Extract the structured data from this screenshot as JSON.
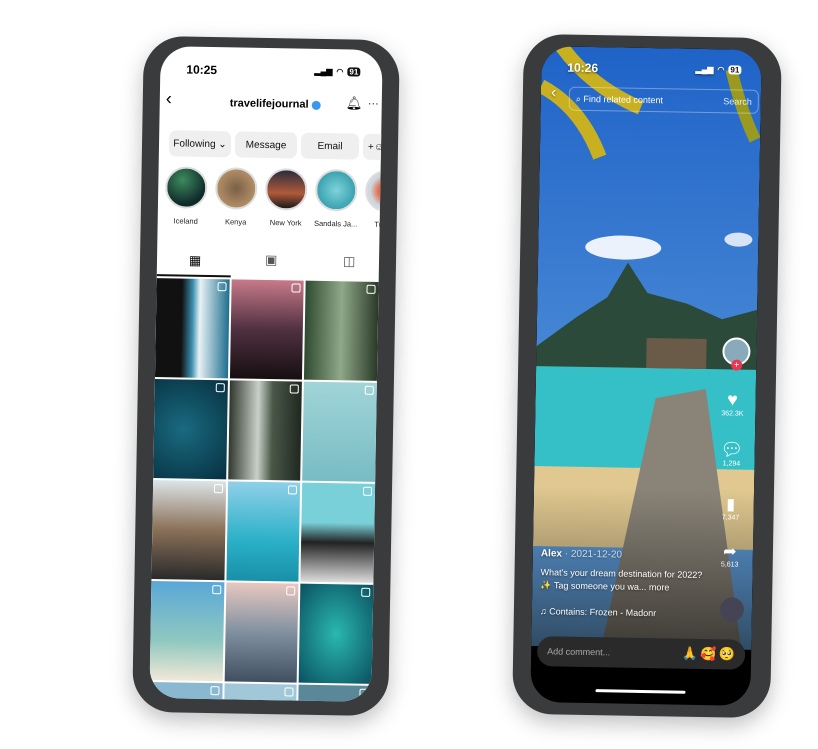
{
  "left_phone": {
    "status": {
      "time": "10:25",
      "battery": "91"
    },
    "header": {
      "back_icon": "chevron-left",
      "username": "travelifejournal",
      "verified_color": "#3897f0",
      "bell_icon": "bell-icon",
      "more_icon": "ellipsis"
    },
    "buttons": {
      "following": "Following",
      "message": "Message",
      "email": "Email"
    },
    "stories": [
      {
        "label": "Iceland"
      },
      {
        "label": "Kenya"
      },
      {
        "label": "New York"
      },
      {
        "label": "Sandals Ja..."
      },
      {
        "label": "Turkey"
      }
    ],
    "tabs": [
      "grid-icon",
      "reels-icon",
      "tagged-icon"
    ],
    "grid_count": 15
  },
  "right_phone": {
    "status": {
      "time": "10:26",
      "battery": "91"
    },
    "search": {
      "placeholder": "Find related content",
      "button": "Search"
    },
    "actions": {
      "likes": "362.3K",
      "comments": "1,294",
      "saves": "7,347",
      "shares": "5,613"
    },
    "post": {
      "author": "Alex",
      "date": "· 2021-12-20",
      "caption": "What's your dream destination for 2022? ✨ Tag someone you wa... more",
      "music": "♫ Contains: Frozen - Madonr"
    },
    "comment": {
      "placeholder": "Add comment...",
      "emojis": [
        "🙏",
        "🥰",
        "🥺"
      ]
    }
  }
}
